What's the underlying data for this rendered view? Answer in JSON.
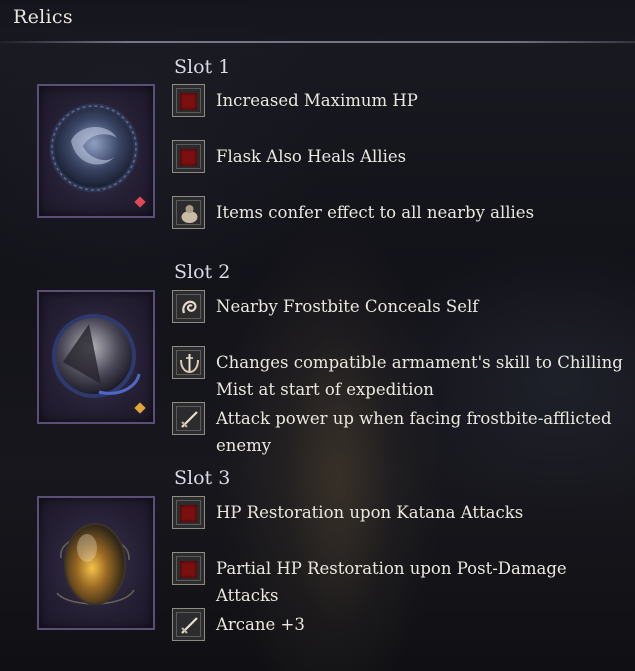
{
  "header": {
    "title": "Relics"
  },
  "slots": [
    {
      "title": "Slot 1",
      "gem_color": "#e04a55",
      "effects": [
        {
          "icon": "red-square-icon",
          "text": "Increased Maximum HP"
        },
        {
          "icon": "red-square-icon",
          "text": "Flask Also Heals Allies"
        },
        {
          "icon": "pouch-icon",
          "text": "Items confer effect to all nearby allies"
        }
      ]
    },
    {
      "title": "Slot 2",
      "gem_color": "#e0a63a",
      "effects": [
        {
          "icon": "swirl-icon",
          "text": "Nearby Frostbite Conceals Self"
        },
        {
          "icon": "armament-skill-icon",
          "text": "Changes compatible armament's skill to Chilling Mist at start of expedition"
        },
        {
          "icon": "sword-icon",
          "text": "Attack power up when facing frostbite-afflicted enemy"
        }
      ]
    },
    {
      "title": "Slot 3",
      "gem_color": "",
      "effects": [
        {
          "icon": "red-square-icon",
          "text": "HP Restoration upon Katana Attacks"
        },
        {
          "icon": "red-square-icon",
          "text": "Partial HP Restoration upon Post-Damage Attacks"
        },
        {
          "icon": "sword-icon",
          "text": "Arcane +3"
        }
      ]
    }
  ]
}
